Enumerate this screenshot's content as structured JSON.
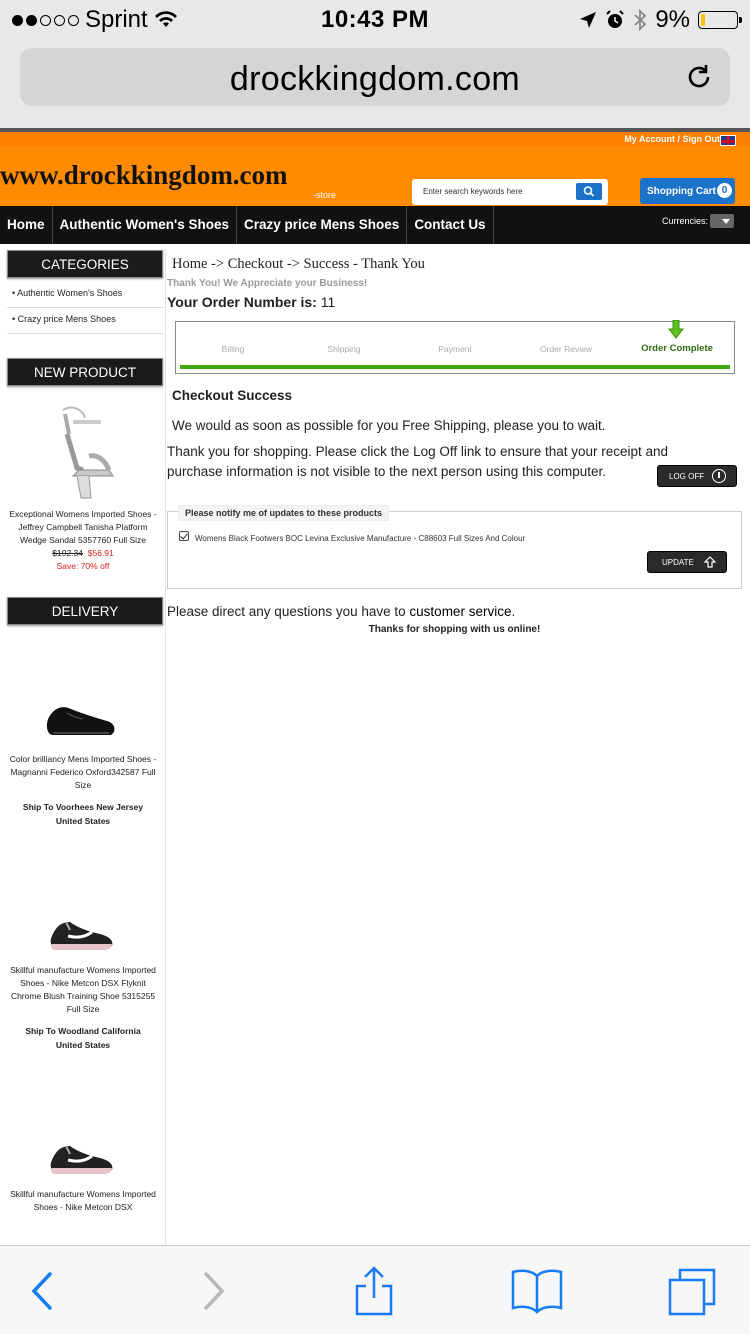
{
  "status_bar": {
    "carrier": "Sprint",
    "time": "10:43 PM",
    "battery": "9%"
  },
  "browser": {
    "url": "drockkingdom.com"
  },
  "header": {
    "my_account": "My Account /",
    "sign_out": "Sign Out",
    "logo": "www.drockkingdom.com",
    "logo_suffix": "-store",
    "search_placeholder": "Enter search keywords here",
    "cart_label": "Shopping Cart",
    "cart_count": "0",
    "currencies_label": "Currencies:"
  },
  "nav": {
    "items": [
      "Home",
      "Authentic Women's Shoes",
      "Crazy price Mens Shoes",
      "Contact Us"
    ]
  },
  "sidebar": {
    "categories_title": "CATEGORIES",
    "categories": [
      "Authentic Women's Shoes",
      "Crazy price Mens Shoes"
    ],
    "new_product_title": "NEW PRODUCT",
    "new_product": {
      "name": "Exceptional Womens Imported Shoes - Jeffrey Campbell Tanisha Platform Wedge Sandal 5357760 Full Size",
      "old_price": "$192.34",
      "new_price": "$56.91",
      "save": "Save: 70% off"
    },
    "delivery_title": "DELIVERY",
    "deliveries": [
      {
        "name": "Color brilliancy Mens Imported Shoes - Magnanni Federico Oxford342587 Full Size",
        "ship": "Ship To Voorhees New Jersey United States"
      },
      {
        "name": "Skillful manufacture Womens Imported Shoes - Nike Metcon DSX Flyknit Chrome Blush Training Shoe 5315255 Full Size",
        "ship": "Ship To Woodland California United States"
      },
      {
        "name": "Skillful manufacture Womens Imported Shoes - Nike Metcon DSX",
        "ship": ""
      }
    ]
  },
  "main": {
    "breadcrumb": "Home ->  Checkout ->  Success - Thank You",
    "thanks": "Thank You! We Appreciate your Business!",
    "order_label": "Your Order Number is:",
    "order_number": "11",
    "steps": [
      "Billing",
      "Shipping",
      "Payment",
      "Order Review",
      "Order Complete"
    ],
    "success_title": "Checkout Success",
    "message1": "We would as soon as possible for you Free Shipping, please you to wait.",
    "message2": "Thank you for shopping. Please click the Log Off link to ensure that your receipt and purchase information is not visible to the next person using this computer.",
    "logoff_label": "LOG OFF",
    "notify_title": "Please notify me of updates to these products",
    "notify_item": "Womens Black Footwers BOC Levina Exclusive Manufacture - C88603 Full Sizes And Colour",
    "update_label": "UPDATE",
    "direct_prefix": "Please direct any questions you have to",
    "customer_service": "customer service",
    "direct_suffix": ".",
    "thanks_shopping": "Thanks for shopping with us online!"
  },
  "colors": {
    "orange": "#ff8c00",
    "nav_black": "#111111",
    "blue": "#1a72c9",
    "progress_green": "#3fa90a",
    "sale_red": "#d81e1e"
  }
}
